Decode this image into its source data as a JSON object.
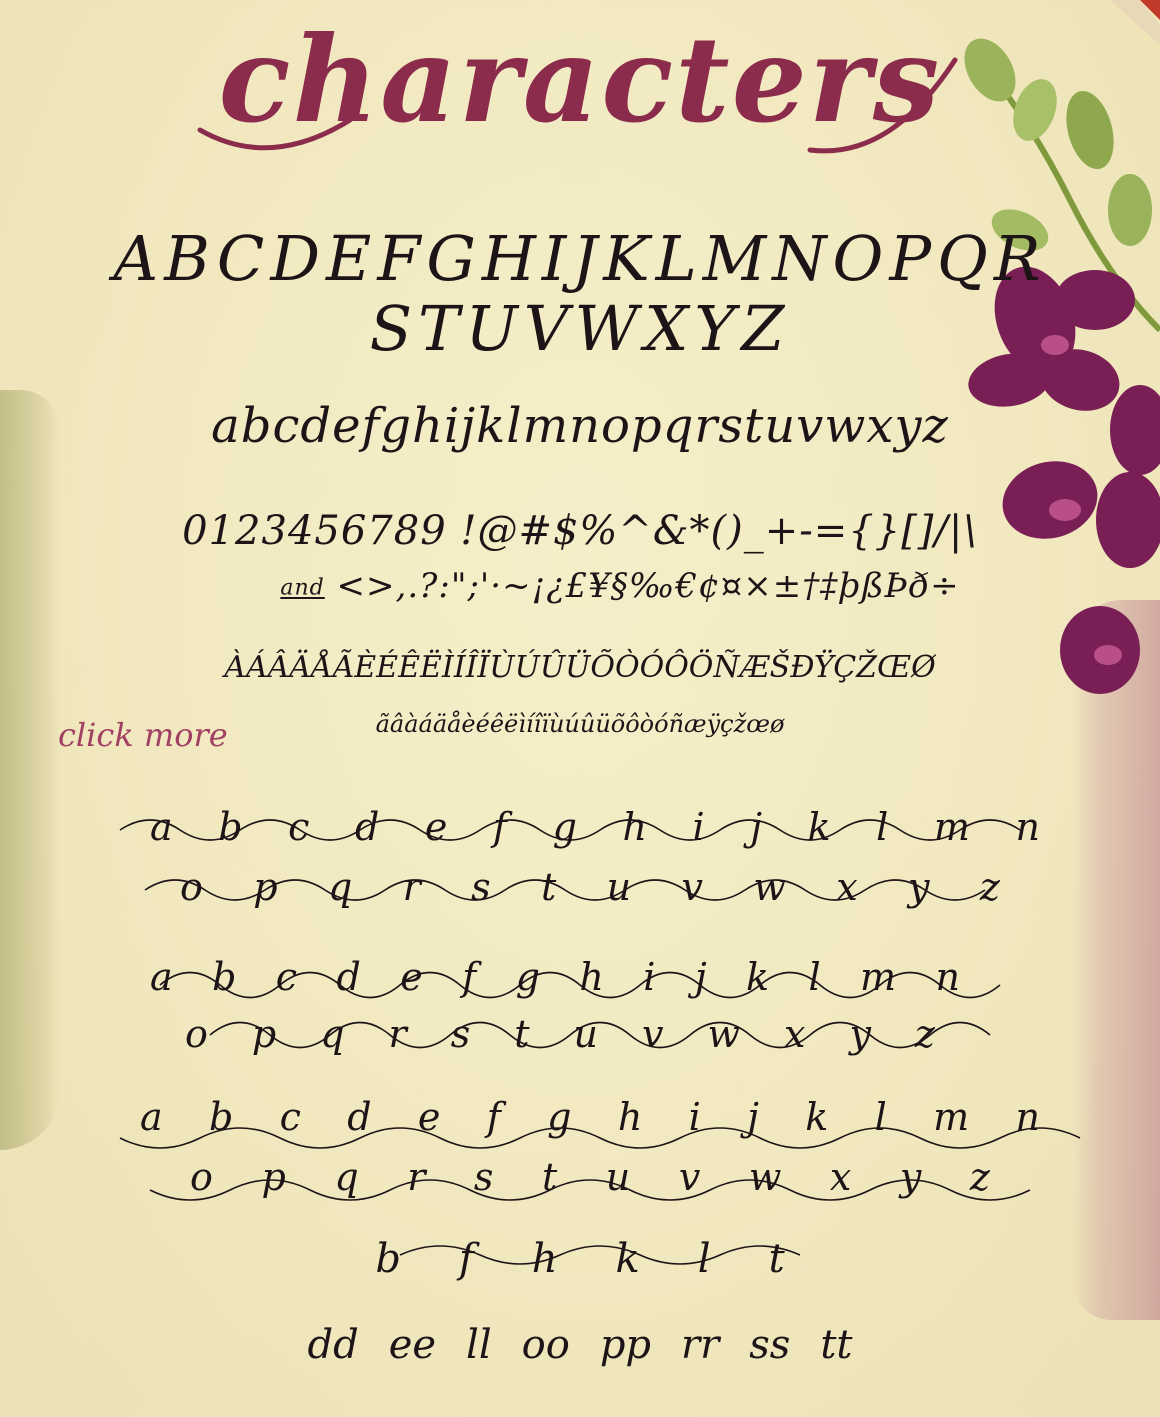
{
  "title": "characters",
  "uppercase_line1": "ABCDEFGHIJKLMNOPQR",
  "uppercase_line2": "STUVWXYZ",
  "lowercase": "abcdefghijklmnopqrstuvwxyz",
  "numerals_symbols": "0123456789 !@#$%^&*()_+-={}[]/|\\",
  "and_ligature": "and",
  "symbols_line2": "<>,.?:\";'·~¡¿£¥§‰€¢¤×±†‡þßÞð÷",
  "accented_upper": "ÀÁÂÄÅÃÈÉÊËÌÍÎÏÙÚÛÜÕÒÓÔÖÑÆŠÐŸÇŽŒØ",
  "accented_lower": "ãâàáäåèéêëìíîïùúûüõôòóñæÿçžœø",
  "click_more": "click more",
  "alt_set1_row1": [
    "a",
    "b",
    "c",
    "d",
    "e",
    "f",
    "g",
    "h",
    "i",
    "j",
    "k",
    "l",
    "m",
    "n"
  ],
  "alt_set1_row2": [
    "o",
    "p",
    "q",
    "r",
    "s",
    "t",
    "u",
    "v",
    "w",
    "x",
    "y",
    "z"
  ],
  "alt_set2_row1": [
    "a",
    "b",
    "c",
    "d",
    "e",
    "f",
    "g",
    "h",
    "i",
    "j",
    "k",
    "l",
    "m",
    "n"
  ],
  "alt_set2_row2": [
    "o",
    "p",
    "q",
    "r",
    "s",
    "t",
    "u",
    "v",
    "w",
    "x",
    "y",
    "z"
  ],
  "alt_set3_row1": [
    "a",
    "b",
    "c",
    "d",
    "e",
    "f",
    "g",
    "h",
    "i",
    "j",
    "k",
    "l",
    "m",
    "n"
  ],
  "alt_set3_row2": [
    "o",
    "p",
    "q",
    "r",
    "s",
    "t",
    "u",
    "v",
    "w",
    "x",
    "y",
    "z"
  ],
  "tall_letters": [
    "b",
    "f",
    "h",
    "k",
    "l",
    "t"
  ],
  "double_letters": [
    "dd",
    "ee",
    "ll",
    "oo",
    "pp",
    "rr",
    "ss",
    "tt"
  ],
  "colors": {
    "title": "#8c2c4d",
    "ink": "#1d1418",
    "click_more": "#a14062",
    "background": "#f2e9c1"
  }
}
